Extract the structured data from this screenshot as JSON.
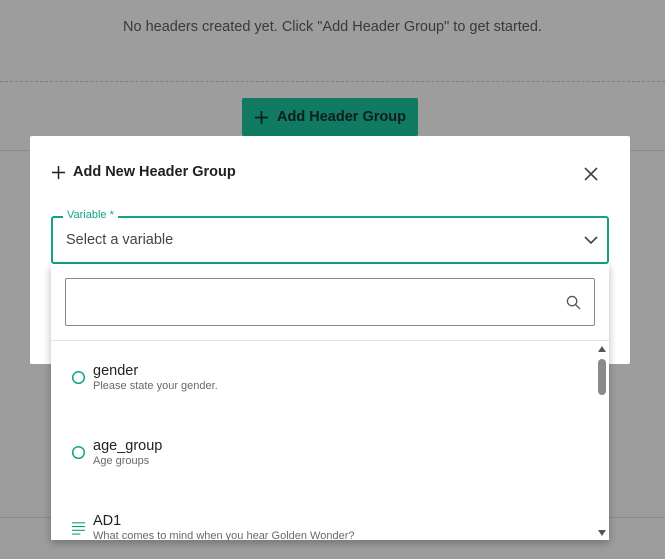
{
  "background": {
    "empty_message": "No headers created yet. Click \"Add Header Group\" to get started.",
    "add_button_label": "Add Header Group"
  },
  "modal": {
    "title": "Add New Header Group",
    "variable_field": {
      "label": "Variable *",
      "placeholder": "Select a variable"
    }
  },
  "dropdown": {
    "search_value": "",
    "options": [
      {
        "name": "gender",
        "description": "Please state your gender.",
        "icon": "radio-circle-icon"
      },
      {
        "name": "age_group",
        "description": "Age groups",
        "icon": "radio-circle-icon"
      },
      {
        "name": "AD1",
        "description": "What comes to mind when you hear Golden Wonder?",
        "icon": "text-lines-icon"
      }
    ]
  },
  "colors": {
    "accent": "#12a384",
    "button_bg": "#107a63",
    "overlay_bg": "#9d9d9d"
  }
}
